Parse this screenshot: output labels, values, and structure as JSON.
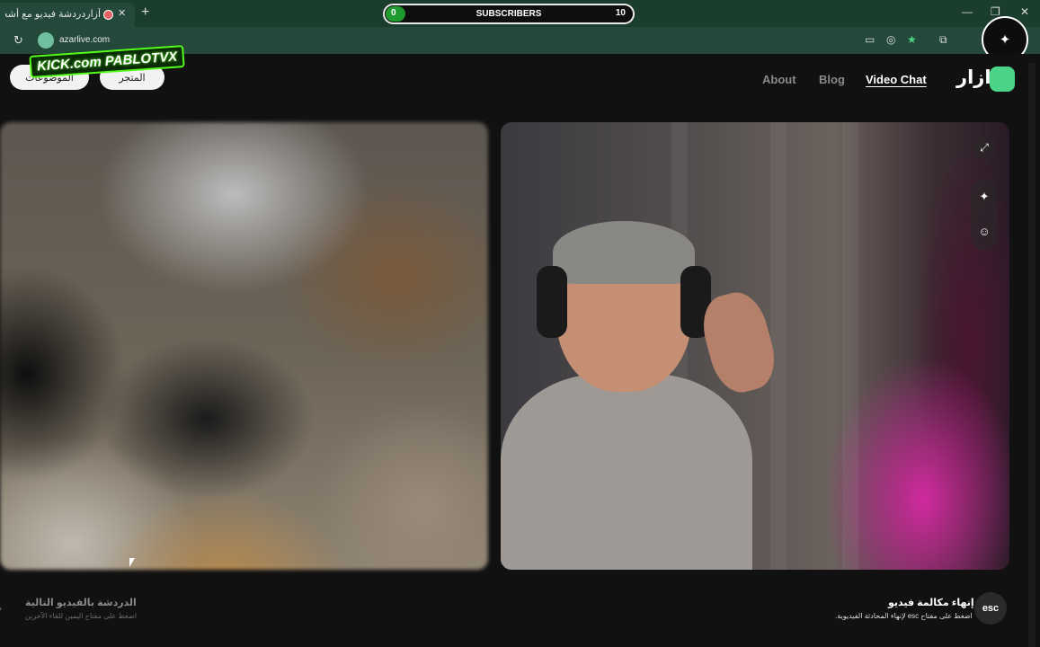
{
  "browser": {
    "tab_title": "أزاردردشة فيديو مع أشخاص",
    "tab_close": "✕",
    "new_tab": "+",
    "url": "azarlive.com",
    "window_controls": [
      "—",
      "❐",
      "✕"
    ]
  },
  "overlay": {
    "subscribers_label": "SUBSCRIBERS",
    "subscribers_current": "0",
    "subscribers_goal": "10",
    "kick_banner": "KICK.com PABLOTVX"
  },
  "header": {
    "pill_left": "الموضوعات",
    "pill_right": "المتجر",
    "nav": [
      {
        "label": "About",
        "active": false
      },
      {
        "label": "Blog",
        "active": false
      },
      {
        "label": "Video Chat",
        "active": true
      }
    ],
    "brand_name": "ازار",
    "brand_color": "#4bd488"
  },
  "video_tools": {
    "expand_icon": "⤢",
    "effects_icon": "✦",
    "face_icon": "☺"
  },
  "footer": {
    "next": {
      "title": "الدردشة بالفيديو التالية",
      "subtitle": "اضغط على مفتاح اليمين للقاء الآخرين"
    },
    "end": {
      "title": "إنهاء مكالمة فيديو",
      "subtitle": "اضغط على مفتاح esc لإنهاء المحادثة الفيديوية.",
      "key": "esc"
    },
    "left_arrow": "›"
  }
}
